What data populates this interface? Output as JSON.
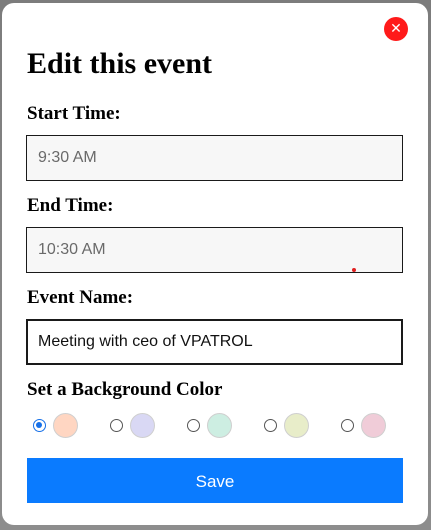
{
  "modal": {
    "title": "Edit this event",
    "close_glyph": "✕"
  },
  "form": {
    "start_time_label": "Start Time:",
    "start_time_value": "9:30 AM",
    "end_time_label": "End Time:",
    "end_time_value": "10:30 AM",
    "event_name_label": "Event Name:",
    "event_name_value": "Meeting with ceo of VPATROL",
    "background_color_label": "Set a Background Color",
    "colors": [
      {
        "hex": "#ffd6c2",
        "selected": true
      },
      {
        "hex": "#d9d8f4",
        "selected": false
      },
      {
        "hex": "#cdeee2",
        "selected": false
      },
      {
        "hex": "#e8edc9",
        "selected": false
      },
      {
        "hex": "#f0ccd8",
        "selected": false
      }
    ],
    "save_label": "Save"
  },
  "theme": {
    "accent": "#0a7bff",
    "close_color": "#ff1a1a"
  }
}
